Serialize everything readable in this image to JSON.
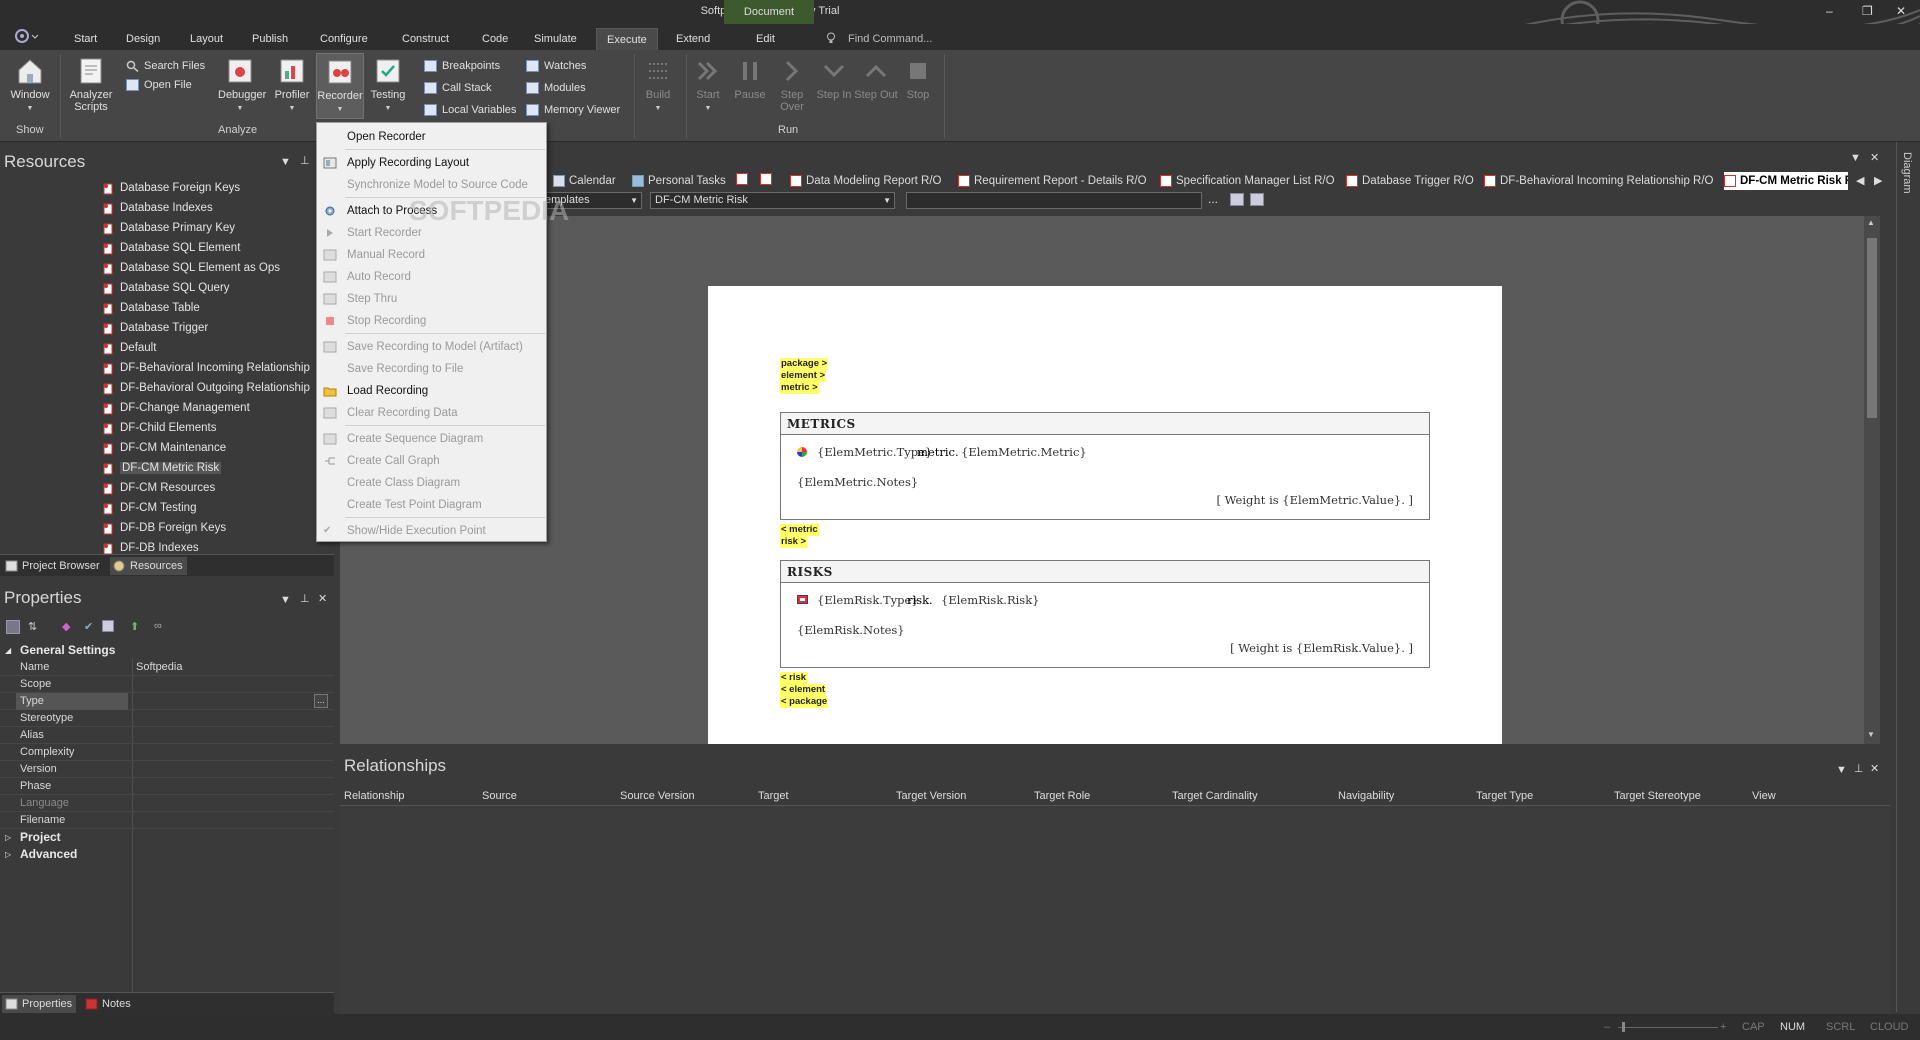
{
  "window": {
    "title": "Softpedia - EA - 30 Day Trial",
    "context_tab_group": "Document"
  },
  "ribbon": {
    "tabs": [
      "Start",
      "Design",
      "Layout",
      "Publish",
      "Configure",
      "Construct",
      "Code",
      "Simulate",
      "Execute",
      "Extend",
      "Edit"
    ],
    "active_tab": "Execute",
    "find_command": "Find Command...",
    "groups": {
      "show": {
        "label": "Show",
        "window_btn": "Window"
      },
      "analyze": {
        "label": "Analyze",
        "analyzer_scripts": "Analyzer Scripts",
        "search_files": "Search Files",
        "open_file": "Open File",
        "debugger": "Debugger",
        "profiler": "Profiler",
        "recorder": "Recorder",
        "testing": "Testing",
        "breakpoints": "Breakpoints",
        "call_stack": "Call Stack",
        "local_variables": "Local Variables",
        "watches": "Watches",
        "modules": "Modules",
        "memory_viewer": "Memory Viewer"
      },
      "run": {
        "label": "Run",
        "build": "Build",
        "start": "Start",
        "pause": "Pause",
        "step_over": "Step Over",
        "step_in": "Step In",
        "step_out": "Step Out",
        "stop": "Stop"
      }
    }
  },
  "recorder_menu": {
    "items": [
      {
        "label": "Open Recorder",
        "enabled": true
      },
      {
        "label": "Apply Recording Layout",
        "enabled": true
      },
      {
        "label": "Synchronize Model to Source Code",
        "enabled": false
      },
      {
        "label": "Attach to Process",
        "enabled": true
      },
      {
        "label": "Start Recorder",
        "enabled": false
      },
      {
        "label": "Manual Record",
        "enabled": false
      },
      {
        "label": "Auto Record",
        "enabled": false
      },
      {
        "label": "Step Thru",
        "enabled": false
      },
      {
        "label": "Stop Recording",
        "enabled": false
      },
      {
        "label": "Save Recording to Model (Artifact)",
        "enabled": false
      },
      {
        "label": "Save Recording to File",
        "enabled": false
      },
      {
        "label": "Load Recording",
        "enabled": true
      },
      {
        "label": "Clear Recording Data",
        "enabled": false
      },
      {
        "label": "Create Sequence Diagram",
        "enabled": false
      },
      {
        "label": "Create Call Graph",
        "enabled": false
      },
      {
        "label": "Create Class Diagram",
        "enabled": false
      },
      {
        "label": "Create Test Point Diagram",
        "enabled": false
      },
      {
        "label": "Show/Hide Execution Point",
        "enabled": false
      }
    ],
    "watermark": "SOFTPEDIA"
  },
  "resources": {
    "title": "Resources",
    "items": [
      "Database Foreign Keys",
      "Database Indexes",
      "Database Primary Key",
      "Database SQL Element",
      "Database SQL Element as Ops",
      "Database SQL Query",
      "Database Table",
      "Database Trigger",
      "Default",
      "DF-Behavioral Incoming Relationship",
      "DF-Behavioral Outgoing Relationship",
      "DF-Change Management",
      "DF-Child Elements",
      "DF-CM Maintenance",
      "DF-CM Metric Risk",
      "DF-CM Resources",
      "DF-CM Testing",
      "DF-DB Foreign Keys",
      "DF-DB Indexes"
    ],
    "selected": "DF-CM Metric Risk",
    "tabs": [
      "Project Browser",
      "Resources"
    ]
  },
  "properties": {
    "title": "Properties",
    "category_general": "General Settings",
    "rows": [
      {
        "key": "Name",
        "value": "Softpedia"
      },
      {
        "key": "Scope",
        "value": ""
      },
      {
        "key": "Type",
        "value": ""
      },
      {
        "key": "Stereotype",
        "value": ""
      },
      {
        "key": "Alias",
        "value": ""
      },
      {
        "key": "Complexity",
        "value": ""
      },
      {
        "key": "Version",
        "value": ""
      },
      {
        "key": "Phase",
        "value": ""
      },
      {
        "key": "Language",
        "value": ""
      },
      {
        "key": "Filename",
        "value": ""
      }
    ],
    "type_button": "...",
    "category_project": "Project",
    "category_advanced": "Advanced",
    "tabs": [
      "Properties",
      "Notes"
    ]
  },
  "document_tabs": [
    "Calendar",
    "Personal Tasks",
    "Data Modeling Report R/O",
    "Requirement Report - Details R/O",
    "Specification Manager List R/O",
    "Database Trigger R/O",
    "DF-Behavioral Incoming Relationship R/O",
    "DF-CM Metric Risk R/O"
  ],
  "editor": {
    "templates_combo": "emplates",
    "template_combo": "DF-CM Metric Risk",
    "search_box": "",
    "ellipsis": "..."
  },
  "template_page": {
    "top_tags": [
      "package >",
      "element >",
      "metric >"
    ],
    "metrics_section": {
      "title": "METRICS",
      "line1_a": "{ElemMetric.Type}",
      "line1_b": "metric.",
      "line1_c": "{ElemMetric.Metric}",
      "notes": "{ElemMetric.Notes}",
      "weight": "[ Weight is {ElemMetric.Value}. ]"
    },
    "mid_tags": [
      "< metric",
      "risk >"
    ],
    "risks_section": {
      "title": "RISKS",
      "line1_a": "{ElemRisk.Type}",
      "line1_b": "risk.",
      "line1_c": "{ElemRisk.Risk}",
      "notes": "{ElemRisk.Notes}",
      "weight": "[ Weight is {ElemRisk.Value}. ]"
    },
    "bottom_tags": [
      "< risk",
      "< element",
      "< package"
    ]
  },
  "right_strip": {
    "label": "Diagram"
  },
  "relationships": {
    "title": "Relationships",
    "columns": [
      "Relationship",
      "Source",
      "Source Version",
      "Target",
      "Target Version",
      "Target Role",
      "Target Cardinality",
      "Navigability",
      "Target Type",
      "Target Stereotype",
      "View"
    ]
  },
  "statusbar": {
    "zoom_minus": "–",
    "zoom_plus": "+",
    "cap": "CAP",
    "num": "NUM",
    "scrl": "SCRL",
    "cloud": "CLOUD"
  }
}
